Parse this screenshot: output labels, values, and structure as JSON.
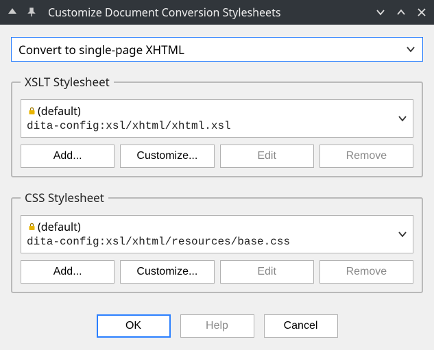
{
  "window": {
    "title": "Customize Document Conversion Stylesheets"
  },
  "convert": {
    "selected": "Convert to single-page XHTML"
  },
  "xslt": {
    "legend": "XSLT Stylesheet",
    "default_label": "(default)",
    "path": "dita-config:xsl/xhtml/xhtml.xsl",
    "buttons": {
      "add": "Add...",
      "customize": "Customize...",
      "edit": "Edit",
      "remove": "Remove"
    }
  },
  "css": {
    "legend": "CSS Stylesheet",
    "default_label": "(default)",
    "path": "dita-config:xsl/xhtml/resources/base.css",
    "buttons": {
      "add": "Add...",
      "customize": "Customize...",
      "edit": "Edit",
      "remove": "Remove"
    }
  },
  "footer": {
    "ok": "OK",
    "help": "Help",
    "cancel": "Cancel"
  }
}
